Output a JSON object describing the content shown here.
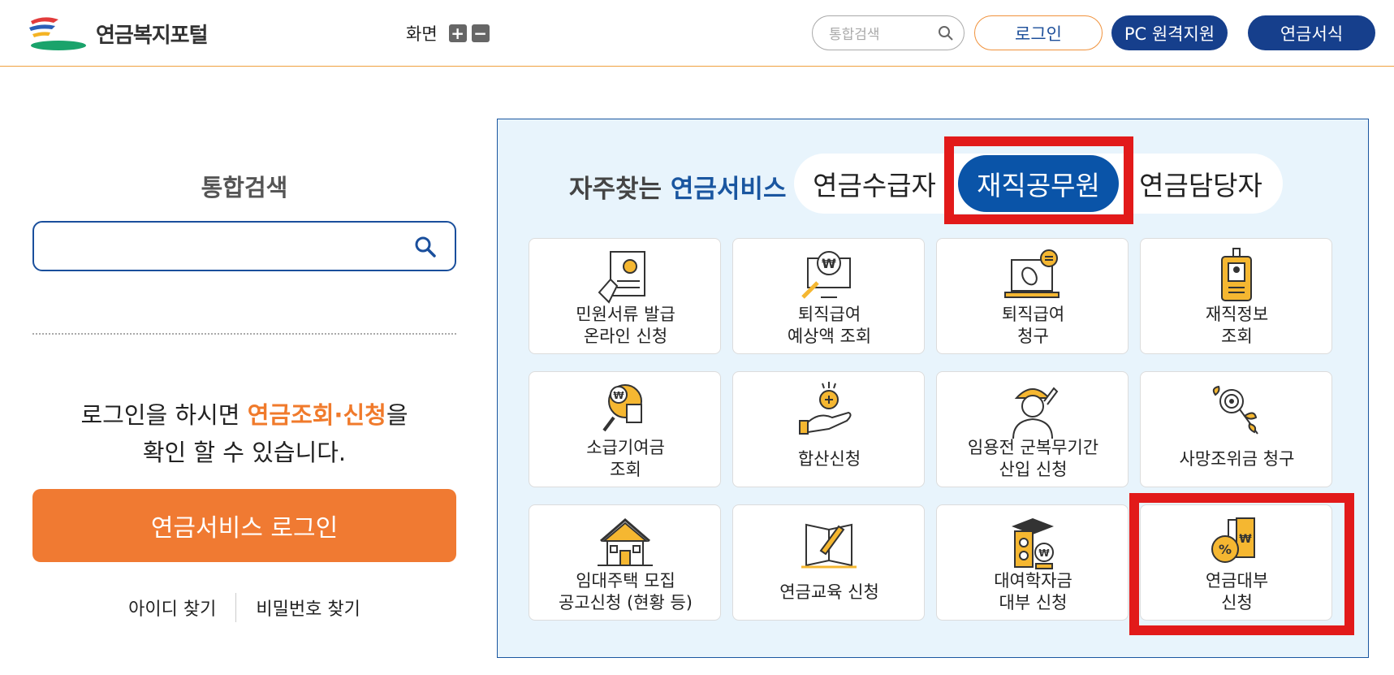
{
  "header": {
    "logo_text": "연금복지포털",
    "zoom_label": "화면",
    "zoom_in": "+",
    "zoom_out": "−",
    "search_placeholder": "통합검색",
    "login_label": "로그인",
    "remote_support_label": "PC 원격지원",
    "forms_label": "연금서식"
  },
  "left": {
    "search_title": "통합검색",
    "search_value": "",
    "msg_line1_pre": "로그인을 하시면 ",
    "msg_line1_hl": "연금조회·신청",
    "msg_line1_post": "을",
    "msg_line2": "확인 할 수 있습니다.",
    "login_button": "연금서비스 로그인",
    "find_id": "아이디 찾기",
    "find_pw": "비밀번호 찾기"
  },
  "services": {
    "title_prefix": "자주찾는 ",
    "title_highlight": "연금서비스",
    "tabs": [
      {
        "label": "연금수급자",
        "active": false
      },
      {
        "label": "재직공무원",
        "active": true
      },
      {
        "label": "연금담당자",
        "active": false
      }
    ],
    "cards": [
      {
        "line1": "민원서류 발급",
        "line2": "온라인 신청",
        "icon": "document-issue-icon"
      },
      {
        "line1": "퇴직급여",
        "line2": "예상액 조회",
        "icon": "won-monitor-icon"
      },
      {
        "line1": "퇴직급여",
        "line2": "청구",
        "icon": "laptop-mouse-icon"
      },
      {
        "line1": "재직정보",
        "line2": "조회",
        "icon": "id-badge-icon"
      },
      {
        "line1": "소급기여금",
        "line2": "조회",
        "icon": "coin-search-icon"
      },
      {
        "line1": "합산신청",
        "line2": "",
        "icon": "hand-coin-icon"
      },
      {
        "line1": "임용전 군복무기간",
        "line2": "산입 신청",
        "icon": "soldier-icon"
      },
      {
        "line1": "사망조위금 청구",
        "line2": "",
        "icon": "flower-icon"
      },
      {
        "line1": "임대주택 모집",
        "line2": "공고신청 (현황 등)",
        "icon": "house-icon"
      },
      {
        "line1": "연금교육 신청",
        "line2": "",
        "icon": "education-icon"
      },
      {
        "line1": "대여학자금",
        "line2": "대부 신청",
        "icon": "scholarship-icon"
      },
      {
        "line1": "연금대부",
        "line2": "신청",
        "icon": "loan-icon"
      }
    ]
  },
  "colors": {
    "navy": "#163f8c",
    "orange": "#f07a32",
    "panel_bg": "#e8f4fc",
    "highlight_red": "#e21a1a",
    "icon_gold": "#f5b731"
  }
}
